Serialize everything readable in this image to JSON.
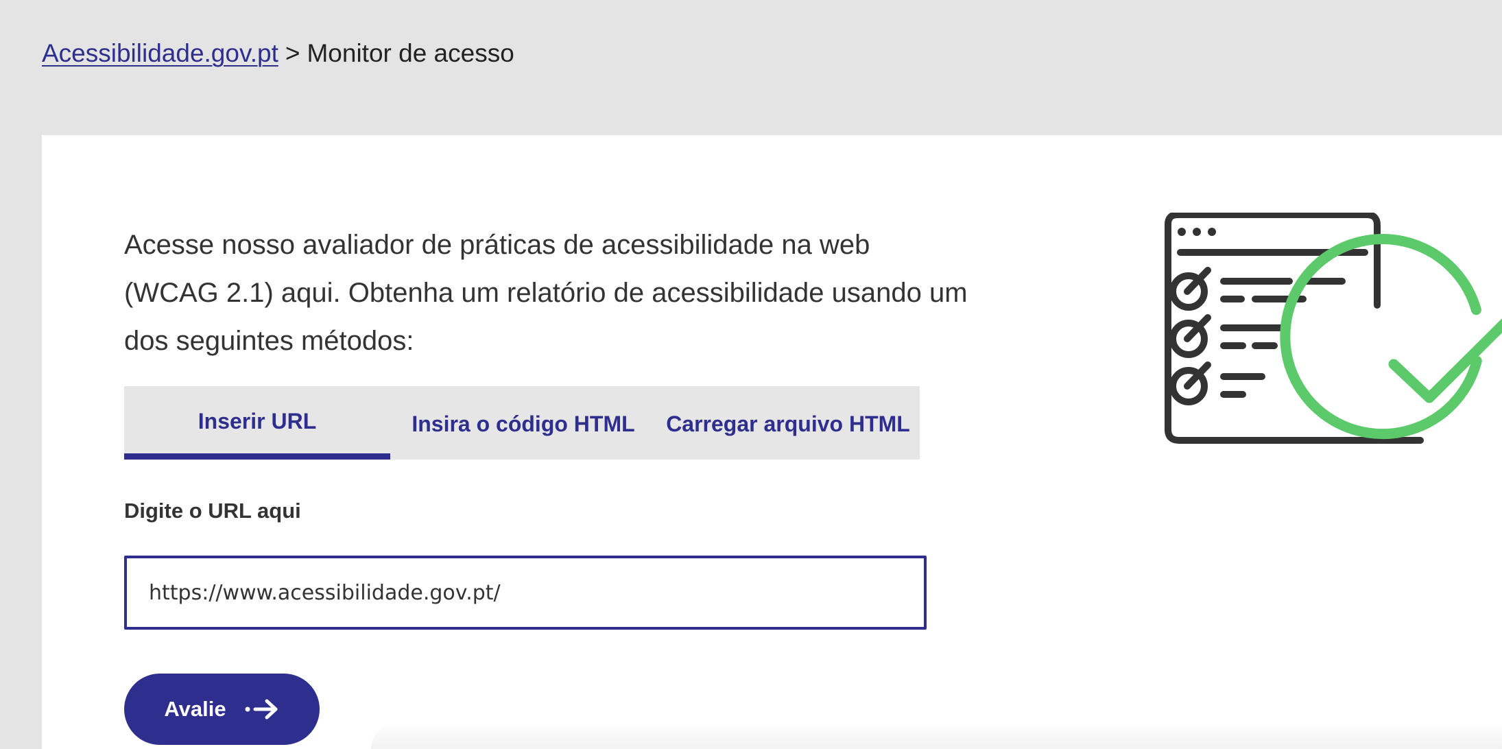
{
  "breadcrumb": {
    "home_link": "Acessibilidade.gov.pt",
    "separator": ">",
    "current": "Monitor de acesso"
  },
  "main": {
    "intro_text": "Acesse nosso avaliador de práticas de acessibilidade na web (WCAG 2.1) aqui. Obtenha um relatório de acessibilidade usando um dos seguintes métodos:",
    "tabs": [
      {
        "label": "Inserir URL",
        "selected": true
      },
      {
        "label": "Insira o código HTML",
        "selected": false
      },
      {
        "label": "Carregar arquivo HTML",
        "selected": false
      }
    ],
    "url_field": {
      "label": "Digite o URL aqui",
      "value": "https://www.acessibilidade.gov.pt/"
    },
    "submit_button": {
      "label": "Avalie",
      "icon": "arrow-right-icon"
    },
    "illustration": {
      "icon": "checklist-check-icon"
    }
  },
  "colors": {
    "accent": "#2e2e8f",
    "page_background": "#e4e4e4",
    "card_background": "#ffffff",
    "check_green": "#5cc96a",
    "icon_dark": "#333333"
  }
}
